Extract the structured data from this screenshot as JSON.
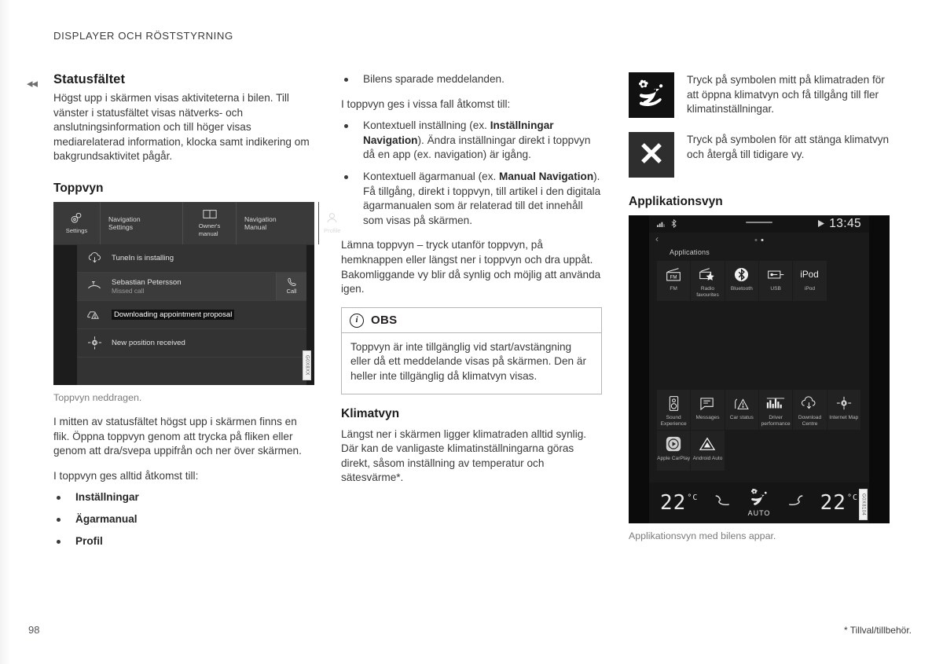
{
  "running_head": "DISPLAYER OCH RÖSTSTYRNING",
  "chapter_marker": "◂◂",
  "col1": {
    "heading": "Statusfältet",
    "intro": "Högst upp i skärmen visas aktiviteterna i bilen. Till vänster i statusfältet visas nätverks- och anslutningsinformation och till höger visas mediarelaterad information, klocka samt indikering om bakgrundsaktivitet pågår.",
    "sub_heading": "Toppvyn",
    "figure_caption": "Toppvyn neddragen.",
    "figure_id": "G0X8XX",
    "para_after_figure": "I mitten av statusfältet högst upp i skärmen finns en flik. Öppna toppvyn genom att trycka på fliken eller genom att dra/svepa uppifrån och ner över skärmen.",
    "list_lead": "I toppvyn ges alltid åtkomst till:",
    "list": [
      "Inställningar",
      "Ägarmanual",
      "Profil"
    ],
    "topview": {
      "tabs": [
        {
          "icon": "settings-gears-icon",
          "label": "Settings"
        },
        {
          "icon": "",
          "label": "Navigation\nSettings"
        },
        {
          "icon": "book-icon",
          "label": "Owner's\nmanual"
        },
        {
          "icon": "",
          "label": "Navigation\nManual"
        },
        {
          "icon": "profile-person-icon",
          "label": "Profile"
        }
      ],
      "notifications": [
        {
          "icon": "cloud-download-icon",
          "title": "TuneIn is installing",
          "subtitle": "",
          "action": ""
        },
        {
          "icon": "missed-call-icon",
          "title": "Sebastian Petersson",
          "subtitle": "Missed call",
          "action": "Call"
        },
        {
          "icon": "car-warning-icon",
          "title": "Downloading appointment proposal",
          "subtitle": "",
          "action": "",
          "highlighted": true
        },
        {
          "icon": "position-crosshair-icon",
          "title": "New position received",
          "subtitle": "",
          "action": ""
        }
      ]
    }
  },
  "col2": {
    "bullet_top": "Bilens sparade meddelanden.",
    "lead": "I toppvyn ges i vissa fall åtkomst till:",
    "bullets": [
      {
        "pre": "Kontextuell inställning (ex. ",
        "bold": "Inställningar Navigation",
        "post": "). Ändra inställningar direkt i toppvyn då en app (ex. navigation) är igång."
      },
      {
        "pre": "Kontextuell ägarmanual (ex. ",
        "bold": "Manual Navigation",
        "post": "). Få tillgång, direkt i toppvyn, till artikel i den digitala ägarmanualen som är relaterad till det innehåll som visas på skärmen."
      }
    ],
    "para": "Lämna toppvyn – tryck utanför toppvyn, på hemknappen eller längst ner i toppvyn och dra uppåt. Bakomliggande vy blir då synlig och möjlig att använda igen.",
    "note": {
      "icon": "info-icon",
      "title": "OBS",
      "body": "Toppvyn är inte tillgänglig vid start/avstängning eller då ett meddelande visas på skärmen. Den är heller inte tillgänglig då klimatvyn visas."
    },
    "klimat_heading": "Klimatvyn",
    "klimat_body": "Längst ner i skärmen ligger klimatraden alltid synlig. Där kan de vanligaste klimatinställningarna göras direkt, såsom inställning av temperatur och sätesvärme*."
  },
  "col3": {
    "symbols": [
      {
        "icon": "climate-fan-seat-icon",
        "text": "Tryck på symbolen mitt på klimatraden för att öppna klimatvyn och få tillgång till fler klimatinställningar."
      },
      {
        "icon": "close-x-icon",
        "text": "Tryck på symbolen för att stänga klimatvyn och återgå till tidigare vy."
      }
    ],
    "app_heading": "Applikationsvyn",
    "app_caption": "Applikationsvyn med bilens appar.",
    "figure_id": "G0X8104",
    "appview": {
      "status": {
        "signal_icon": "signal-bars-icon",
        "bluetooth_icon": "bluetooth-icon",
        "media_icon": "play-icon",
        "clock": "13:45"
      },
      "back_icon": "chevron-left-icon",
      "title": "Applications",
      "page_dots": 2,
      "active_dot": 2,
      "apps_row1": [
        {
          "icon": "fm-radio-icon",
          "label": "FM"
        },
        {
          "icon": "radio-favourite-star-icon",
          "label": "Radio favourites"
        },
        {
          "icon": "bluetooth-icon",
          "label": "Bluetooth"
        },
        {
          "icon": "usb-icon",
          "label": "USB"
        },
        {
          "icon": "ipod-icon",
          "label": "iPod"
        }
      ],
      "apps_row2": [
        {
          "icon": "speaker-sound-icon",
          "label": "Sound Experience"
        },
        {
          "icon": "messages-icon",
          "label": "Messages"
        },
        {
          "icon": "car-status-warning-icon",
          "label": "Car status"
        },
        {
          "icon": "driver-performance-icon",
          "label": "Driver performance"
        },
        {
          "icon": "download-centre-icon",
          "label": "Download Centre"
        },
        {
          "icon": "internet-map-icon",
          "label": "Internet Map"
        }
      ],
      "apps_row3": [
        {
          "icon": "apple-carplay-icon",
          "label": "Apple CarPlay"
        },
        {
          "icon": "android-auto-icon",
          "label": "Android Auto"
        }
      ],
      "climate": {
        "temp_left": "22",
        "unit_left": "°C",
        "seat_left_icon": "seat-heat-icon",
        "auto_icon": "climate-fan-seat-icon",
        "auto_label": "AUTO",
        "seat_right_icon": "seat-heat-icon",
        "temp_right": "22",
        "unit_right": "°C"
      }
    }
  },
  "footer": {
    "page_number": "98",
    "footnote": "* Tillval/tillbehör."
  }
}
